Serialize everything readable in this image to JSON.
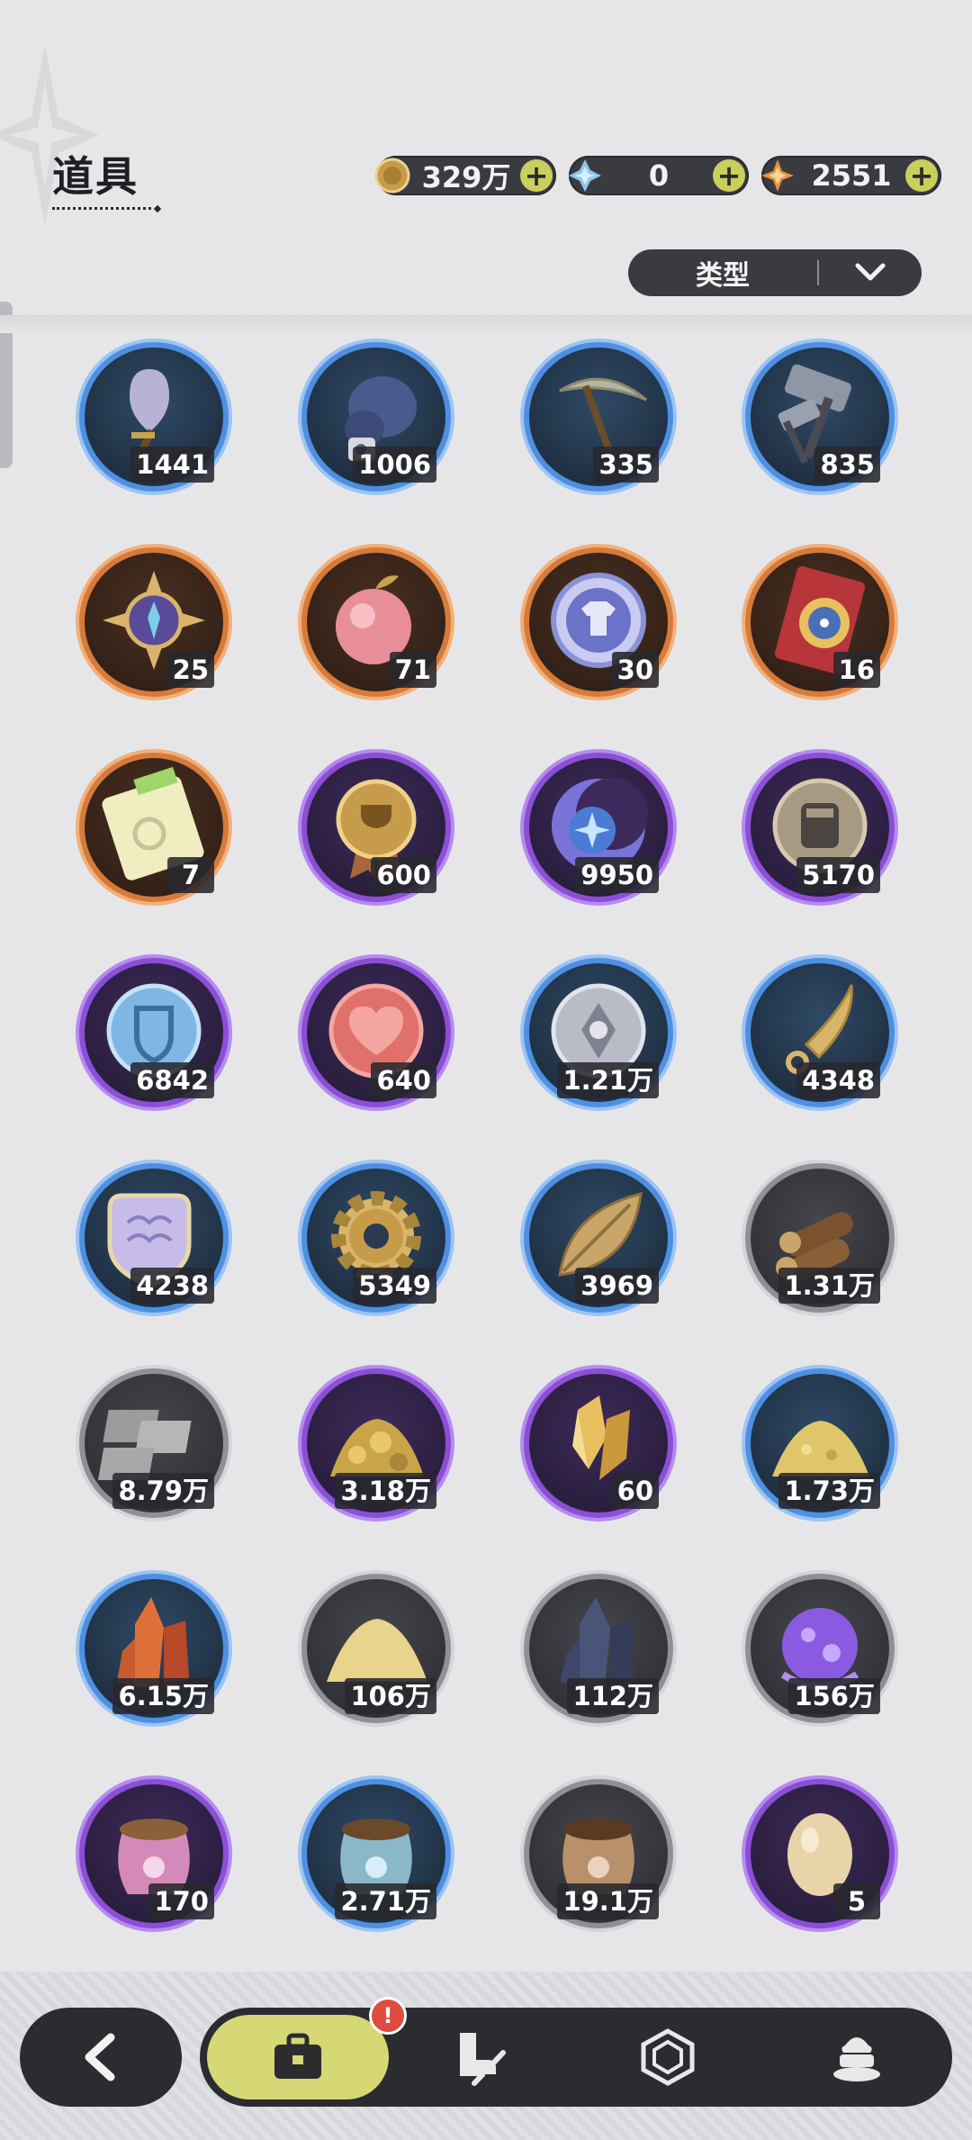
{
  "header": {
    "title": "道具"
  },
  "currencies": [
    {
      "name": "gold-coin",
      "value": "329万"
    },
    {
      "name": "crystal",
      "value": "0"
    },
    {
      "name": "star-shard",
      "value": "2551"
    }
  ],
  "filter": {
    "label": "类型"
  },
  "items": [
    {
      "icon": "shovel-icon",
      "count": "1441",
      "rarity": "blue"
    },
    {
      "icon": "boxing-glove-icon",
      "count": "1006",
      "rarity": "blue"
    },
    {
      "icon": "pickaxe-icon",
      "count": "335",
      "rarity": "blue"
    },
    {
      "icon": "hammer-icon",
      "count": "835",
      "rarity": "blue"
    },
    {
      "icon": "compass-emblem-icon",
      "count": "25",
      "rarity": "orange"
    },
    {
      "icon": "peach-icon",
      "count": "71",
      "rarity": "orange"
    },
    {
      "icon": "outfit-token-icon",
      "count": "30",
      "rarity": "orange"
    },
    {
      "icon": "wheel-ticket-icon",
      "count": "16",
      "rarity": "orange"
    },
    {
      "icon": "rainbow-ticket-icon",
      "count": "7",
      "rarity": "orange"
    },
    {
      "icon": "trophy-medal-icon",
      "count": "600",
      "rarity": "purple"
    },
    {
      "icon": "moon-star-coin-icon",
      "count": "9950",
      "rarity": "purple"
    },
    {
      "icon": "fist-coin-icon",
      "count": "5170",
      "rarity": "purple"
    },
    {
      "icon": "shield-coin-icon",
      "count": "6842",
      "rarity": "purple"
    },
    {
      "icon": "heart-coin-icon",
      "count": "640",
      "rarity": "purple"
    },
    {
      "icon": "silver-emblem-coin-icon",
      "count": "1.21万",
      "rarity": "blue"
    },
    {
      "icon": "blade-icon",
      "count": "4348",
      "rarity": "blue"
    },
    {
      "icon": "scale-icon",
      "count": "4238",
      "rarity": "blue"
    },
    {
      "icon": "gear-icon",
      "count": "5349",
      "rarity": "blue"
    },
    {
      "icon": "leaf-icon",
      "count": "3969",
      "rarity": "blue"
    },
    {
      "icon": "logs-icon",
      "count": "1.31万",
      "rarity": "gray"
    },
    {
      "icon": "stone-bricks-icon",
      "count": "8.79万",
      "rarity": "gray"
    },
    {
      "icon": "gold-ore-pile-icon",
      "count": "3.18万",
      "rarity": "purple"
    },
    {
      "icon": "gold-crystal-icon",
      "count": "60",
      "rarity": "purple"
    },
    {
      "icon": "gold-sand-pile-icon",
      "count": "1.73万",
      "rarity": "blue"
    },
    {
      "icon": "red-crystal-icon",
      "count": "6.15万",
      "rarity": "blue"
    },
    {
      "icon": "sand-pile-icon",
      "count": "106万",
      "rarity": "gray"
    },
    {
      "icon": "dark-crystal-icon",
      "count": "112万",
      "rarity": "gray"
    },
    {
      "icon": "purple-orb-icon",
      "count": "156万",
      "rarity": "gray"
    },
    {
      "icon": "pink-food-sack-icon",
      "count": "170",
      "rarity": "purple"
    },
    {
      "icon": "blue-food-sack-icon",
      "count": "2.71万",
      "rarity": "blue"
    },
    {
      "icon": "brown-food-sack-icon",
      "count": "19.1万",
      "rarity": "gray"
    },
    {
      "icon": "egg-icon",
      "count": "5",
      "rarity": "purple"
    }
  ],
  "nav": {
    "badge": "!",
    "tabs": [
      {
        "icon": "bag-icon",
        "active": true
      },
      {
        "icon": "boot-sword-icon",
        "active": false
      },
      {
        "icon": "hexagon-gem-icon",
        "active": false
      },
      {
        "icon": "pudding-icon",
        "active": false
      }
    ]
  }
}
